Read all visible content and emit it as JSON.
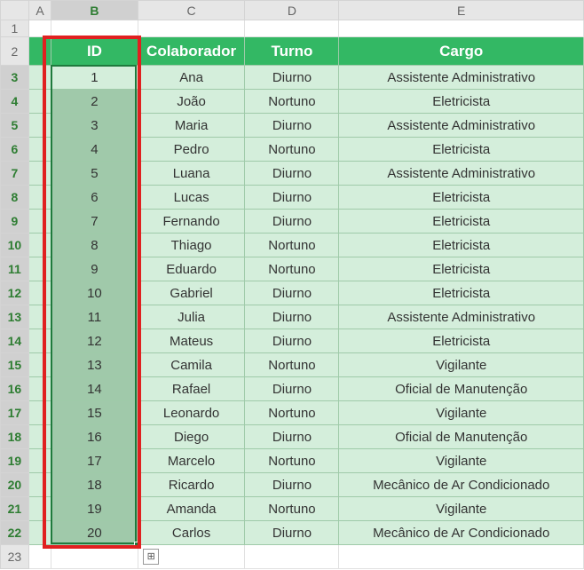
{
  "columns": [
    "A",
    "B",
    "C",
    "D",
    "E"
  ],
  "row_numbers": [
    1,
    2,
    3,
    4,
    5,
    6,
    7,
    8,
    9,
    10,
    11,
    12,
    13,
    14,
    15,
    16,
    17,
    18,
    19,
    20,
    21,
    22,
    23
  ],
  "header": {
    "id": "ID",
    "colab": "Colaborador",
    "turno": "Turno",
    "cargo": "Cargo"
  },
  "rows": [
    {
      "id": "1",
      "colab": "Ana",
      "turno": "Diurno",
      "cargo": "Assistente Administrativo"
    },
    {
      "id": "2",
      "colab": "João",
      "turno": "Nortuno",
      "cargo": "Eletricista"
    },
    {
      "id": "3",
      "colab": "Maria",
      "turno": "Diurno",
      "cargo": "Assistente Administrativo"
    },
    {
      "id": "4",
      "colab": "Pedro",
      "turno": "Nortuno",
      "cargo": "Eletricista"
    },
    {
      "id": "5",
      "colab": "Luana",
      "turno": "Diurno",
      "cargo": "Assistente Administrativo"
    },
    {
      "id": "6",
      "colab": "Lucas",
      "turno": "Diurno",
      "cargo": "Eletricista"
    },
    {
      "id": "7",
      "colab": "Fernando",
      "turno": "Diurno",
      "cargo": "Eletricista"
    },
    {
      "id": "8",
      "colab": "Thiago",
      "turno": "Nortuno",
      "cargo": "Eletricista"
    },
    {
      "id": "9",
      "colab": "Eduardo",
      "turno": "Nortuno",
      "cargo": "Eletricista"
    },
    {
      "id": "10",
      "colab": "Gabriel",
      "turno": "Diurno",
      "cargo": "Eletricista"
    },
    {
      "id": "11",
      "colab": "Julia",
      "turno": "Diurno",
      "cargo": "Assistente Administrativo"
    },
    {
      "id": "12",
      "colab": "Mateus",
      "turno": "Diurno",
      "cargo": "Eletricista"
    },
    {
      "id": "13",
      "colab": "Camila",
      "turno": "Nortuno",
      "cargo": "Vigilante"
    },
    {
      "id": "14",
      "colab": "Rafael",
      "turno": "Diurno",
      "cargo": "Oficial de Manutenção"
    },
    {
      "id": "15",
      "colab": "Leonardo",
      "turno": "Nortuno",
      "cargo": "Vigilante"
    },
    {
      "id": "16",
      "colab": "Diego",
      "turno": "Diurno",
      "cargo": "Oficial de Manutenção"
    },
    {
      "id": "17",
      "colab": "Marcelo",
      "turno": "Nortuno",
      "cargo": "Vigilante"
    },
    {
      "id": "18",
      "colab": "Ricardo",
      "turno": "Diurno",
      "cargo": "Mecânico de Ar Condicionado"
    },
    {
      "id": "19",
      "colab": "Amanda",
      "turno": "Nortuno",
      "cargo": "Vigilante"
    },
    {
      "id": "20",
      "colab": "Carlos",
      "turno": "Diurno",
      "cargo": "Mecânico de Ar Condicionado"
    }
  ],
  "selection": {
    "range": "B3:B22",
    "active": "B3"
  },
  "autofill_glyph": "⊞",
  "chart_data": {
    "type": "table",
    "title": "",
    "columns": [
      "ID",
      "Colaborador",
      "Turno",
      "Cargo"
    ],
    "rows": [
      [
        1,
        "Ana",
        "Diurno",
        "Assistente Administrativo"
      ],
      [
        2,
        "João",
        "Nortuno",
        "Eletricista"
      ],
      [
        3,
        "Maria",
        "Diurno",
        "Assistente Administrativo"
      ],
      [
        4,
        "Pedro",
        "Nortuno",
        "Eletricista"
      ],
      [
        5,
        "Luana",
        "Diurno",
        "Assistente Administrativo"
      ],
      [
        6,
        "Lucas",
        "Diurno",
        "Eletricista"
      ],
      [
        7,
        "Fernando",
        "Diurno",
        "Eletricista"
      ],
      [
        8,
        "Thiago",
        "Nortuno",
        "Eletricista"
      ],
      [
        9,
        "Eduardo",
        "Nortuno",
        "Eletricista"
      ],
      [
        10,
        "Gabriel",
        "Diurno",
        "Eletricista"
      ],
      [
        11,
        "Julia",
        "Diurno",
        "Assistente Administrativo"
      ],
      [
        12,
        "Mateus",
        "Diurno",
        "Eletricista"
      ],
      [
        13,
        "Camila",
        "Nortuno",
        "Vigilante"
      ],
      [
        14,
        "Rafael",
        "Diurno",
        "Oficial de Manutenção"
      ],
      [
        15,
        "Leonardo",
        "Nortuno",
        "Vigilante"
      ],
      [
        16,
        "Diego",
        "Diurno",
        "Oficial de Manutenção"
      ],
      [
        17,
        "Marcelo",
        "Nortuno",
        "Vigilante"
      ],
      [
        18,
        "Ricardo",
        "Diurno",
        "Mecânico de Ar Condicionado"
      ],
      [
        19,
        "Amanda",
        "Nortuno",
        "Vigilante"
      ],
      [
        20,
        "Carlos",
        "Diurno",
        "Mecânico de Ar Condicionado"
      ]
    ]
  }
}
